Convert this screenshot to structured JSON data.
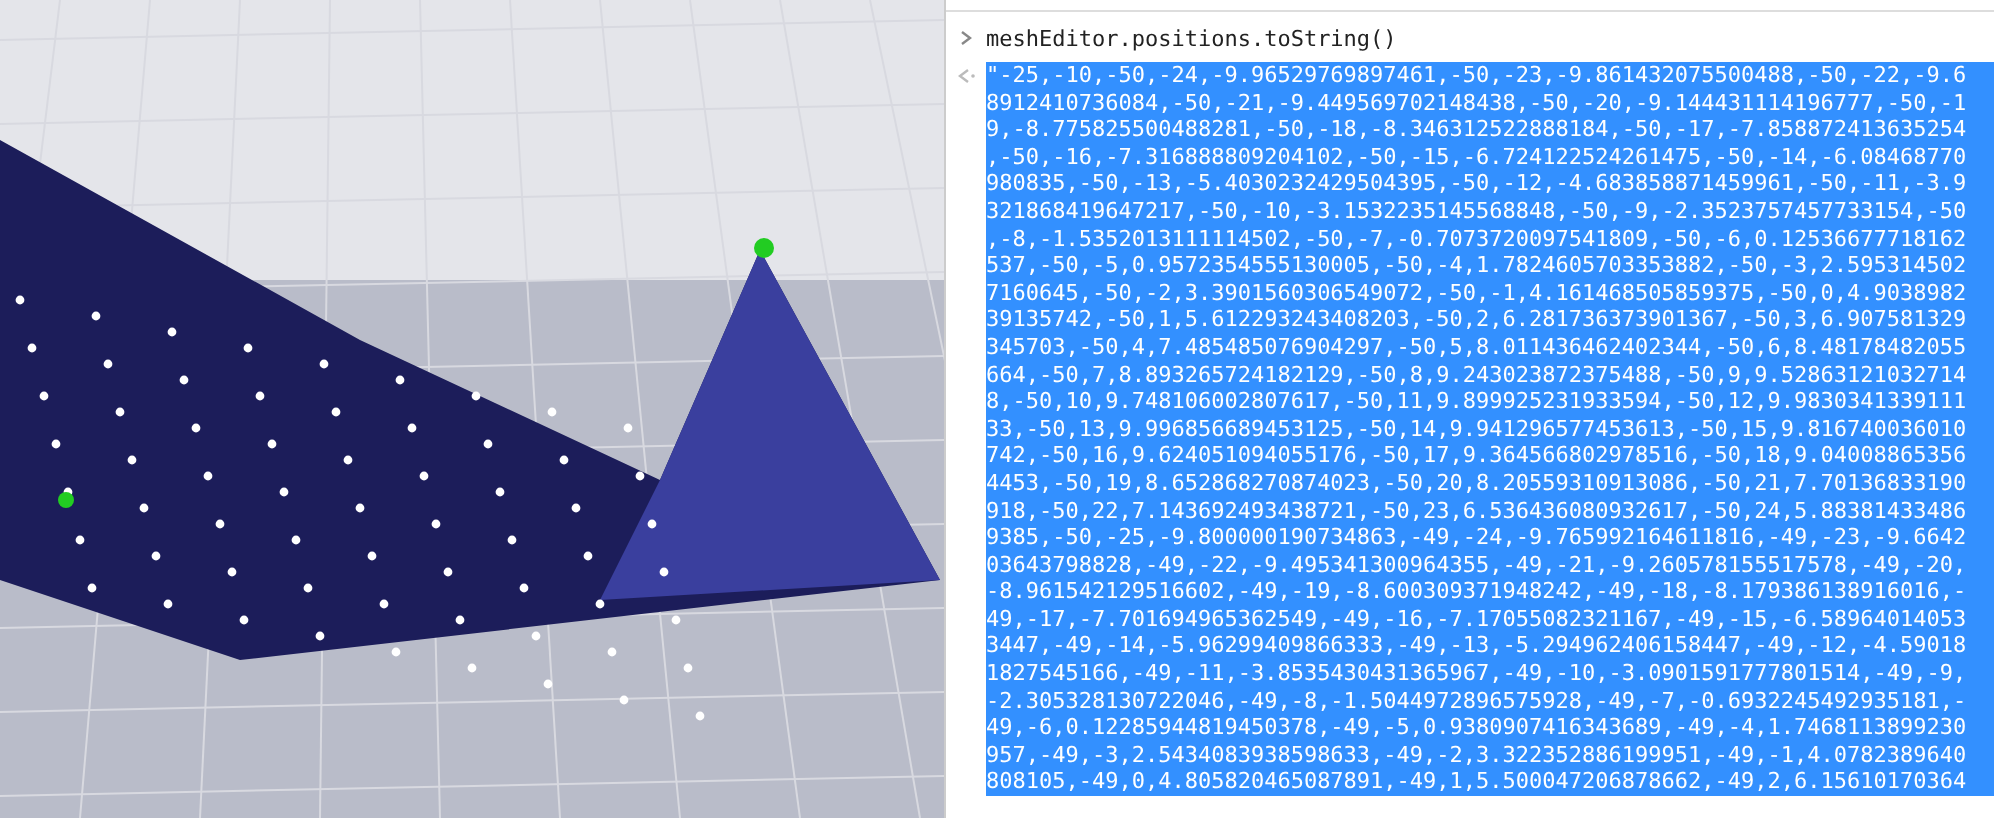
{
  "console": {
    "command": "meshEditor.positions.toString()",
    "result_selected": true,
    "result_lines": [
      "\"-25,-10,-50,-24,-9.96529769897461,-50,-23,-9.861432075500488,-50,-22,-9.6",
      "8912410736084,-50,-21,-9.449569702148438,-50,-20,-9.144431114196777,-50,-1",
      "9,-8.775825500488281,-50,-18,-8.346312522888184,-50,-17,-7.858872413635254",
      ",-50,-16,-7.316888809204102,-50,-15,-6.724122524261475,-50,-14,-6.08468770",
      "980835,-50,-13,-5.4030232429504395,-50,-12,-4.683858871459961,-50,-11,-3.9",
      "321868419647217,-50,-10,-3.1532235145568848,-50,-9,-2.3523757457733154,-50",
      ",-8,-1.5352013111114502,-50,-7,-0.7073720097541809,-50,-6,0.12536677718162",
      "537,-50,-5,0.9572354555130005,-50,-4,1.7824605703353882,-50,-3,2.595314502",
      "7160645,-50,-2,3.3901560306549072,-50,-1,4.161468505859375,-50,0,4.9038982",
      "39135742,-50,1,5.612293243408203,-50,2,6.281736373901367,-50,3,6.907581329",
      "345703,-50,4,7.485485076904297,-50,5,8.011436462402344,-50,6,8.48178482055",
      "664,-50,7,8.893265724182129,-50,8,9.243023872375488,-50,9,9.52863121032714",
      "8,-50,10,9.748106002807617,-50,11,9.899925231933594,-50,12,9.9830341339111",
      "33,-50,13,9.996856689453125,-50,14,9.941296577453613,-50,15,9.816740036010",
      "742,-50,16,9.624051094055176,-50,17,9.364566802978516,-50,18,9.04008865356",
      "4453,-50,19,8.652868270874023,-50,20,8.20559310913086,-50,21,7.70136833190",
      "918,-50,22,7.143692493438721,-50,23,6.536436080932617,-50,24,5.88381433486",
      "9385,-50,-25,-9.800000190734863,-49,-24,-9.765992164611816,-49,-23,-9.6642",
      "03643798828,-49,-22,-9.495341300964355,-49,-21,-9.260578155517578,-49,-20,",
      "-8.961542129516602,-49,-19,-8.600309371948242,-49,-18,-8.179386138916016,-",
      "49,-17,-7.701694965362549,-49,-16,-7.17055082321167,-49,-15,-6.58964014053",
      "3447,-49,-14,-5.96299409866333,-49,-13,-5.294962406158447,-49,-12,-4.59018",
      "1827545166,-49,-11,-3.8535430431365967,-49,-10,-3.0901591777801514,-49,-9,",
      "-2.305328130722046,-49,-8,-1.5044972896575928,-49,-7,-0.6932245492935181,-",
      "49,-6,0.12285944819450378,-49,-5,0.9380907416343689,-49,-4,1.7468113899230",
      "957,-49,-3,2.5434083938598633,-49,-2,3.322352886199951,-49,-1,4.0782389640",
      "808105,-49,0,4.805820465087891,-49,1,5.500047206878662,-49,2,6.15610170364"
    ]
  }
}
